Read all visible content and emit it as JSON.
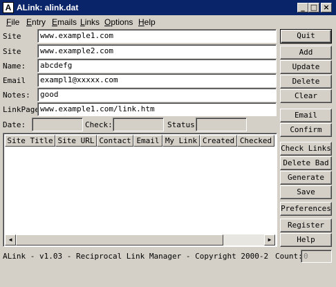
{
  "window": {
    "title": "ALink: alink.dat",
    "icon_letter": "A"
  },
  "menu": [
    {
      "label": "File",
      "mn": "F",
      "rest": "ile"
    },
    {
      "label": "Entry",
      "mn": "E",
      "rest": "ntry"
    },
    {
      "label": "Emails",
      "mn": "E",
      "rest": "mails"
    },
    {
      "label": "Links",
      "mn": "L",
      "rest": "inks"
    },
    {
      "label": "Options",
      "mn": "O",
      "rest": "ptions"
    },
    {
      "label": "Help",
      "mn": "H",
      "rest": "elp"
    }
  ],
  "form": {
    "site_label": "Site",
    "site_value": "www.example1.com",
    "site2_label": "Site",
    "site2_value": "www.example2.com",
    "name_label": "Name:",
    "name_value": "abcdefg",
    "email_label": "Email",
    "email_value": "exampl1@xxxxx.com",
    "notes_label": "Notes:",
    "notes_value": "good",
    "linkpage_label": "LinkPage",
    "linkpage_value": "www.example1.com/link.htm",
    "date_label": "Date:",
    "date_value": "",
    "check_label": "Check:",
    "check_value": "",
    "status_label": "Status",
    "status_value": ""
  },
  "buttons": {
    "quit": "Quit",
    "add": "Add",
    "update": "Update",
    "delete": "Delete",
    "clear": "Clear",
    "email": "Email",
    "confirm": "Confirm",
    "check_links": "Check Links",
    "delete_bad": "Delete Bad",
    "generate": "Generate",
    "save": "Save",
    "preferences": "Preferences",
    "register": "Register",
    "help": "Help"
  },
  "list": {
    "columns": [
      "Site Title",
      "Site URL",
      "Contact",
      "Email",
      "My Link",
      "Created",
      "Checked"
    ]
  },
  "statusbar": {
    "text": "ALink - v1.03 - Reciprocal Link Manager - Copyright 2000-2",
    "count_label": "Count:",
    "count_value": "0"
  }
}
